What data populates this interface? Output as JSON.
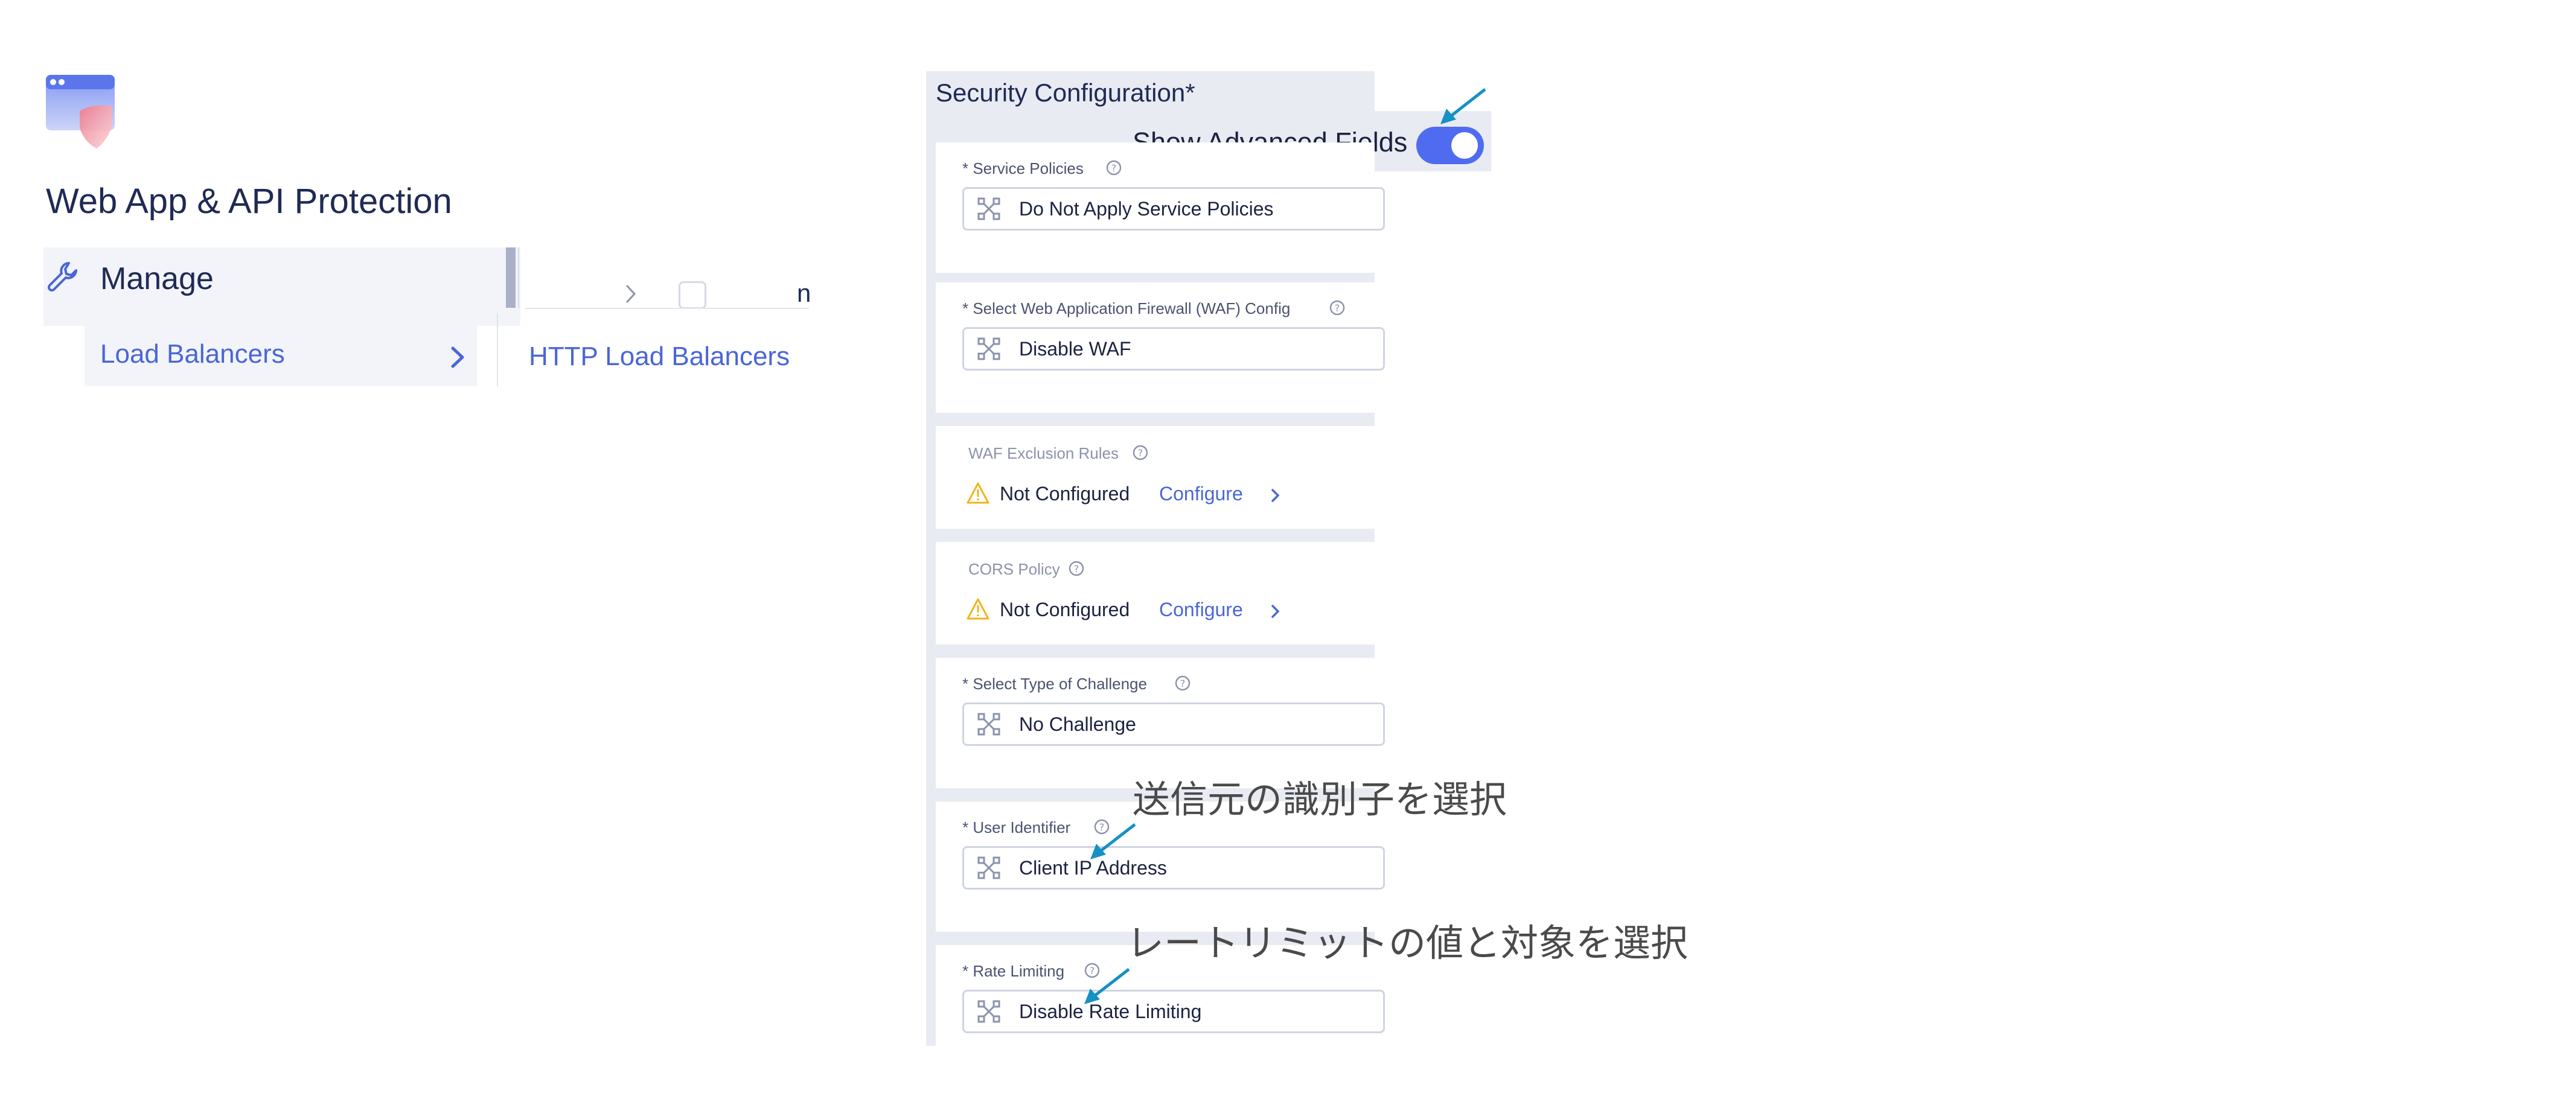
{
  "app": {
    "title": "Web App & API Protection",
    "logo_icon": "waap-shield-logo-icon"
  },
  "nav": {
    "section_label": "Manage",
    "section_icon": "wrench-icon",
    "item_label": "Load Balancers",
    "item_chevron_icon": "chevron-right-icon",
    "flyout_item_label": "HTTP Load Balancers",
    "list_partial_text": "n"
  },
  "panel": {
    "title": "Security Configuration",
    "required_marker": "*",
    "advanced_toggle": {
      "label": "Show Advanced Fields",
      "on": true,
      "color": "#4f6cf0"
    },
    "fields": {
      "service_policies": {
        "label": "* Service Policies",
        "value": "Do Not Apply Service Policies"
      },
      "waf_config": {
        "label": "* Select Web Application Firewall (WAF) Config",
        "value": "Disable WAF"
      },
      "waf_exclusion": {
        "label": "WAF Exclusion Rules",
        "status": "Not Configured",
        "link": "Configure"
      },
      "cors_policy": {
        "label": "CORS Policy",
        "status": "Not Configured",
        "link": "Configure"
      },
      "challenge": {
        "label": "* Select Type of Challenge",
        "value": "No Challenge"
      },
      "user_identifier": {
        "label": "* User Identifier",
        "value": "Client IP Address"
      },
      "rate_limiting": {
        "label": "* Rate Limiting",
        "value": "Disable Rate Limiting"
      }
    }
  },
  "annotations": {
    "user_identifier_note": "送信元の識別子を選択",
    "rate_limit_note": "レートリミットの値と対象を選択",
    "arrow_color": "#1591c4"
  }
}
